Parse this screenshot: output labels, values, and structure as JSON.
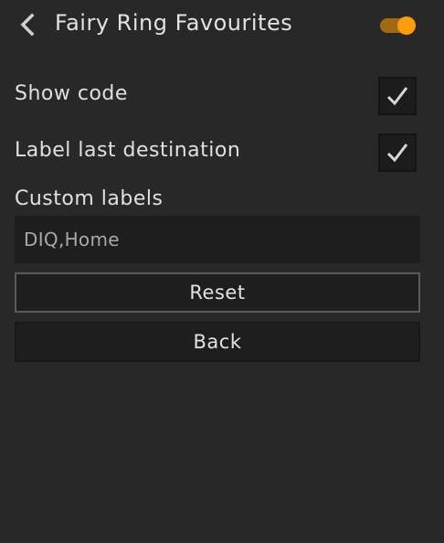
{
  "header": {
    "title": "Fairy Ring Favourites",
    "back_icon": "chevron-left-icon",
    "plugin_toggle": {
      "state": "on",
      "accent_color": "#ff9c0a"
    }
  },
  "settings": {
    "show_code": {
      "label": "Show code",
      "checked": true
    },
    "label_last_destination": {
      "label": "Label last destination",
      "checked": true
    },
    "custom_labels": {
      "label": "Custom labels",
      "value": "DIQ,Home"
    }
  },
  "buttons": {
    "reset_label": "Reset",
    "back_label": "Back"
  }
}
